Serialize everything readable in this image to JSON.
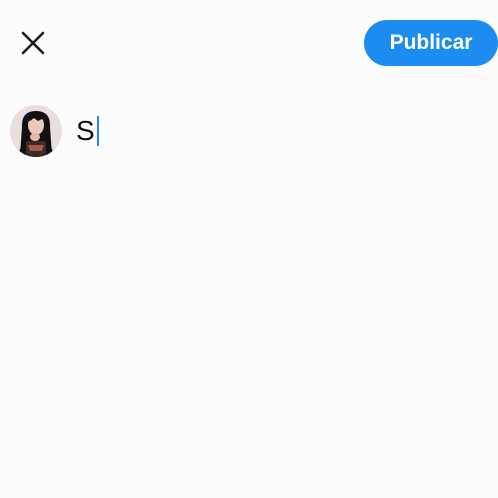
{
  "header": {
    "close_icon": "close-icon",
    "publish_label": "Publicar",
    "accent_color": "#1d8cf0"
  },
  "composer": {
    "text": "S",
    "caret_color": "#1d8cf0"
  },
  "avatar": {
    "icon": "user-avatar"
  }
}
